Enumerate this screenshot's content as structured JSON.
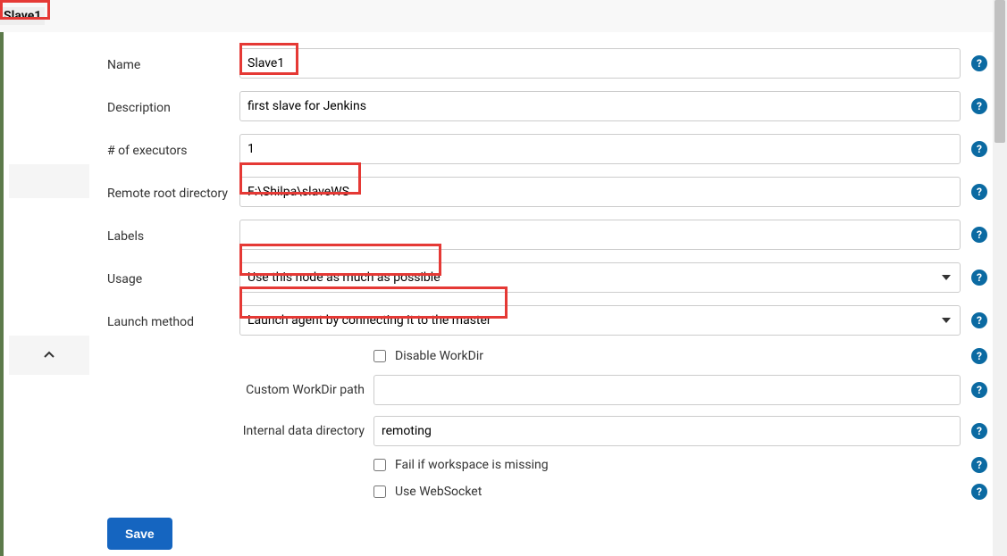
{
  "header": {
    "title": "Slave1"
  },
  "form": {
    "name": {
      "label": "Name",
      "value": "Slave1"
    },
    "description": {
      "label": "Description",
      "value": "first slave for Jenkins"
    },
    "executors": {
      "label": "# of executors",
      "value": "1"
    },
    "remote_root": {
      "label": "Remote root directory",
      "value": "F:\\Shilpa\\slaveWS"
    },
    "labels": {
      "label": "Labels",
      "value": ""
    },
    "usage": {
      "label": "Usage",
      "value": "Use this node as much as possible"
    },
    "launch_method": {
      "label": "Launch method",
      "value": "Launch agent by connecting it to the master"
    },
    "disable_workdir": {
      "label": "Disable WorkDir"
    },
    "custom_workdir": {
      "label": "Custom WorkDir path",
      "value": ""
    },
    "internal_data_dir": {
      "label": "Internal data directory",
      "value": "remoting"
    },
    "fail_if_missing": {
      "label": "Fail if workspace is missing"
    },
    "use_websocket": {
      "label": "Use WebSocket"
    }
  },
  "buttons": {
    "save": "Save"
  },
  "help_glyph": "?"
}
